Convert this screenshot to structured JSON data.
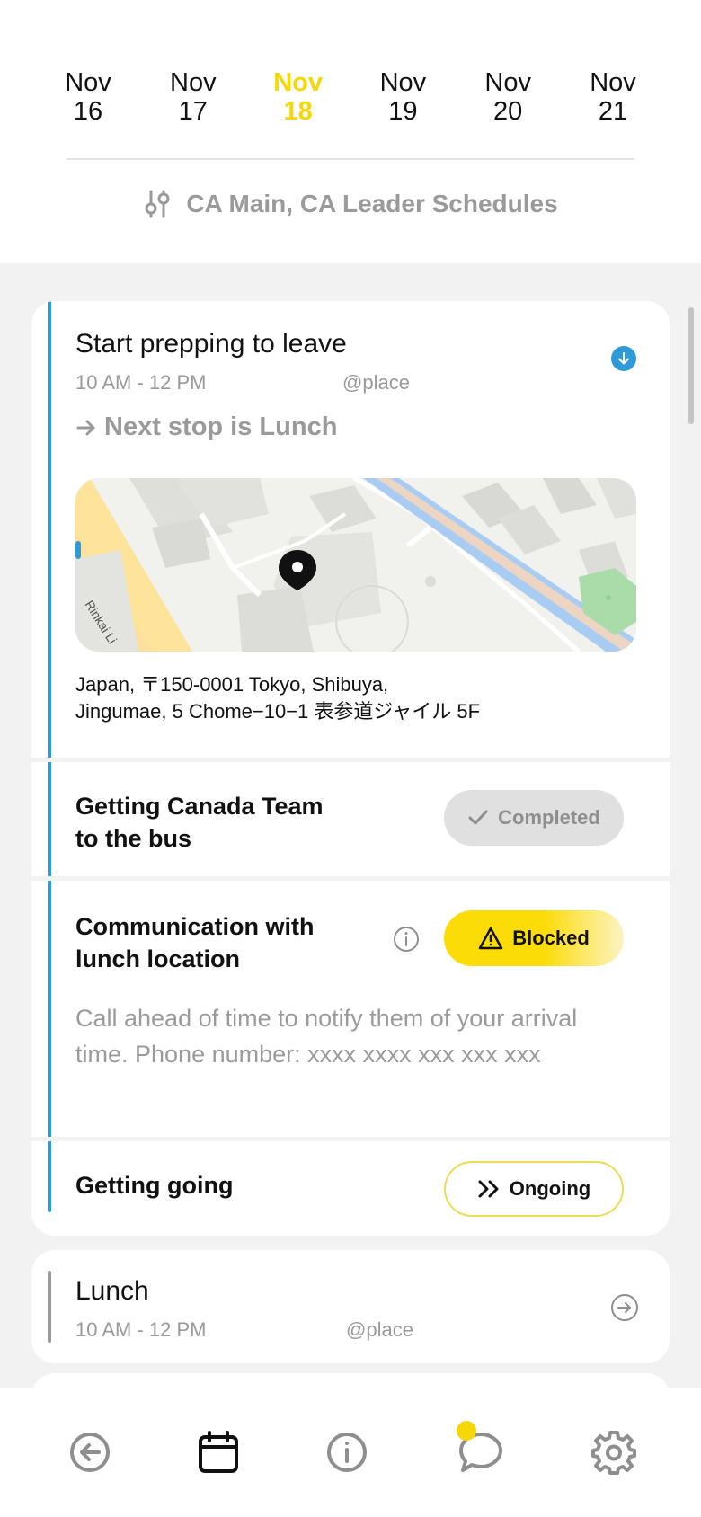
{
  "dates": [
    {
      "month": "Nov",
      "day": "16",
      "active": false
    },
    {
      "month": "Nov",
      "day": "17",
      "active": false
    },
    {
      "month": "Nov",
      "day": "18",
      "active": true
    },
    {
      "month": "Nov",
      "day": "19",
      "active": false
    },
    {
      "month": "Nov",
      "day": "20",
      "active": false
    },
    {
      "month": "Nov",
      "day": "21",
      "active": false
    }
  ],
  "schedule_filter": {
    "label": "CA Main, CA Leader Schedules",
    "icon": "sliders-icon"
  },
  "event": {
    "title": "Start prepping to leave",
    "time": "10 AM - 12 PM",
    "place": "@place",
    "next_stop": "Next stop is Lunch",
    "map": {
      "street_label": "Rinkai Li"
    },
    "address_line1": "Japan, 〒150-0001 Tokyo, Shibuya,",
    "address_line2": "Jingumae, 5 Chome−10−1 表参道ジャイル 5F"
  },
  "tasks": [
    {
      "title_line1": "Getting Canada Team",
      "title_line2": "to the bus",
      "status": "Completed",
      "status_icon": "check-icon"
    },
    {
      "title_line1": "Communication with",
      "title_line2": "lunch location",
      "status": "Blocked",
      "status_icon": "warning-icon",
      "description": "Call ahead of time to notify them of your arrival time. Phone number: xxxx xxxx xxx xxx xxx"
    },
    {
      "title_line1": "Getting going",
      "status": "Ongoing",
      "status_icon": "double-chevron-right-icon"
    }
  ],
  "next_event": {
    "title": "Lunch",
    "time": "10 AM - 12 PM",
    "place": "@place"
  },
  "nav": [
    {
      "icon": "back-circle-icon"
    },
    {
      "icon": "calendar-icon",
      "active": true
    },
    {
      "icon": "info-icon"
    },
    {
      "icon": "chat-icon",
      "has_notification": true
    },
    {
      "icon": "settings-icon"
    }
  ],
  "colors": {
    "accent_yellow": "#f6d70a",
    "accent_blue": "#2d9bd8",
    "muted_text": "#999999"
  }
}
